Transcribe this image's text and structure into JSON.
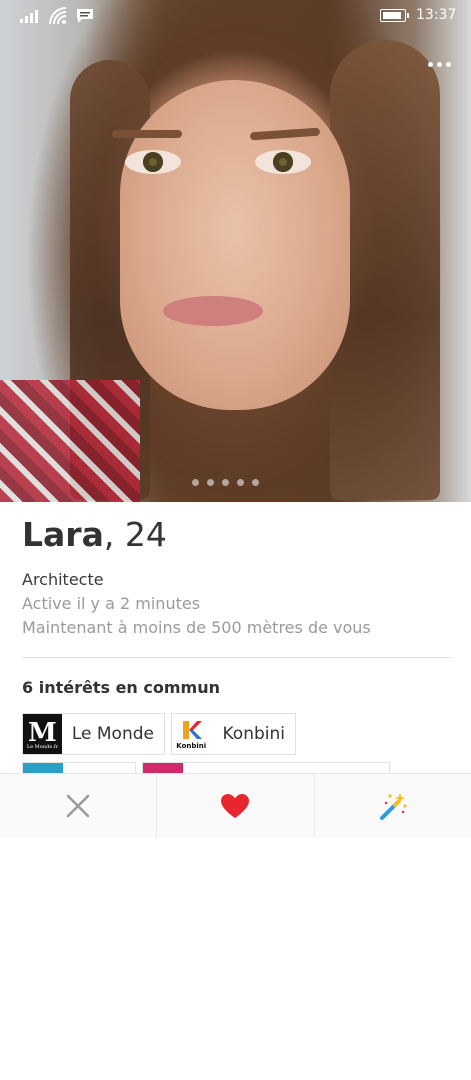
{
  "status_bar": {
    "time": "13:37",
    "icons": [
      "signal-icon",
      "wifi-icon",
      "message-icon",
      "battery-icon"
    ]
  },
  "photo": {
    "alt_icon": "profile-photo",
    "pager": {
      "count": 6,
      "active": 1
    }
  },
  "profile": {
    "name": "Lara",
    "separator": ",",
    "age": "24",
    "job": "Architecte",
    "activity": "Active il y a 2 minutes",
    "distance": "Maintenant à moins de 500 mètres de vous"
  },
  "interests": {
    "title": "6 intérêts en commun",
    "items": [
      {
        "label": "Le Monde",
        "logo_text": "M",
        "logo_subtext": "Le Monde.fr"
      },
      {
        "label": "Konbini",
        "logo_text": "Konbini"
      }
    ]
  },
  "actions": {
    "icons": [
      "close-icon",
      "heart-icon",
      "magic-wand-icon"
    ]
  },
  "colors": {
    "accent": "#e8262f",
    "text": "#333333",
    "muted": "#9a9a9a",
    "wand_yellow": "#f4c020",
    "wand_blue": "#2e9be0"
  }
}
